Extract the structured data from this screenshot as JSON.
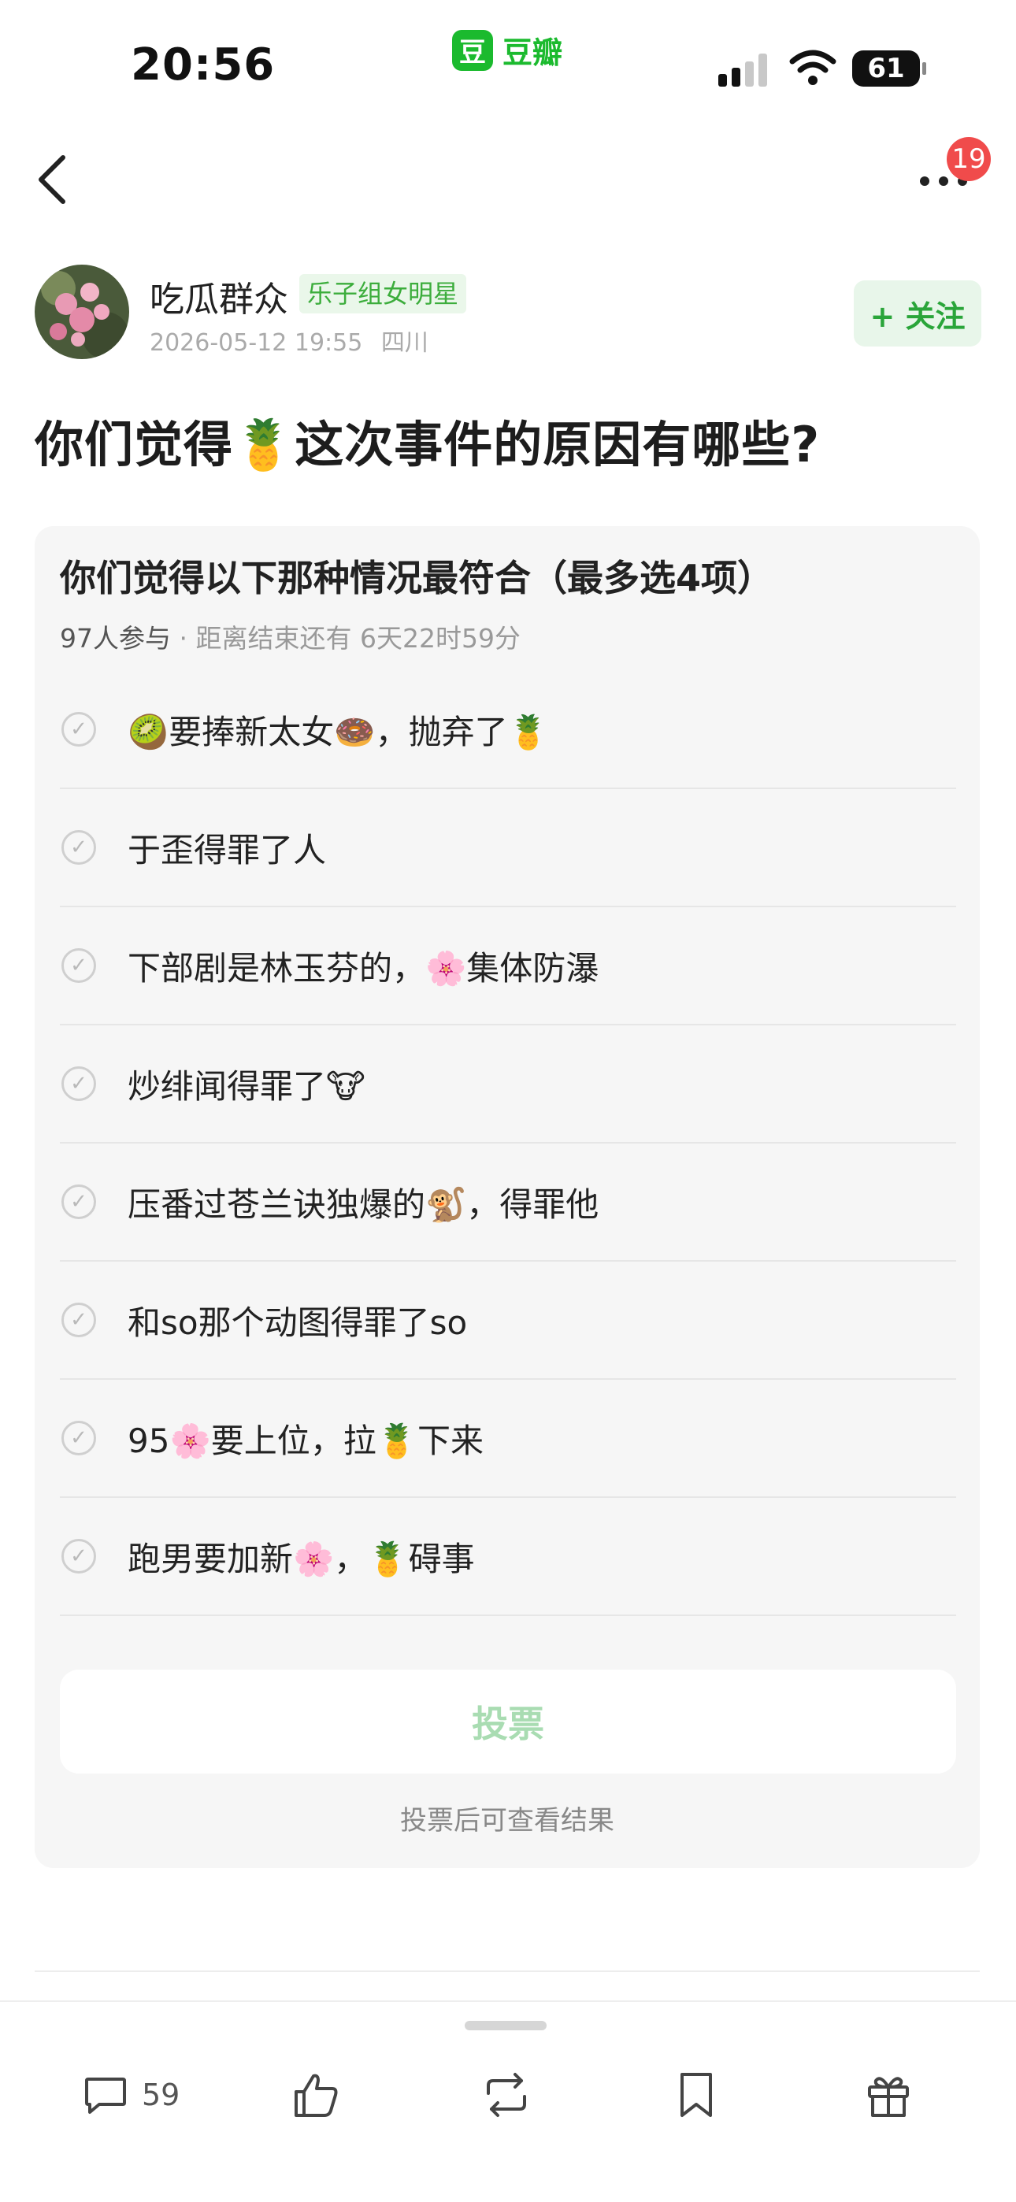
{
  "status_bar": {
    "time": "20:56",
    "app_logo_char": "豆",
    "app_name": "豆瓣",
    "battery": "61",
    "brand_color": "#1bba2e"
  },
  "nav": {
    "back_icon": "chevron-left-icon",
    "more_icon": "more-dots-icon",
    "notification_count": "19"
  },
  "author": {
    "name": "吃瓜群众",
    "tag": "乐子组女明星",
    "date": "2026-05-12 19:55",
    "location": "四川",
    "follow_label": "+ 关注"
  },
  "post": {
    "title": "你们觉得🍍这次事件的原因有哪些?"
  },
  "poll": {
    "title": "你们觉得以下那种情况最符合（最多选4项）",
    "participants": "97人参与",
    "remaining": " · 距离结束还有 6天22时59分",
    "options": [
      "🥝要捧新太女🍩，抛弃了🍍",
      "于歪得罪了人",
      "下部剧是林玉芬的，🌸集体防瀑",
      "炒绯闻得罪了🐮",
      "压番过苍兰诀独爆的🐒，得罪他",
      "和so那个动图得罪了so",
      "95🌸要上位，拉🍍下来",
      "跑男要加新🌸，🍍碍事"
    ],
    "vote_label": "投票",
    "vote_hint": "投票后可查看结果"
  },
  "bottom_bar": {
    "comment_icon": "comment-icon",
    "comment_count": "59",
    "like_icon": "thumbs-up-icon",
    "repost_icon": "repost-icon",
    "bookmark_icon": "bookmark-icon",
    "gift_icon": "gift-icon"
  }
}
